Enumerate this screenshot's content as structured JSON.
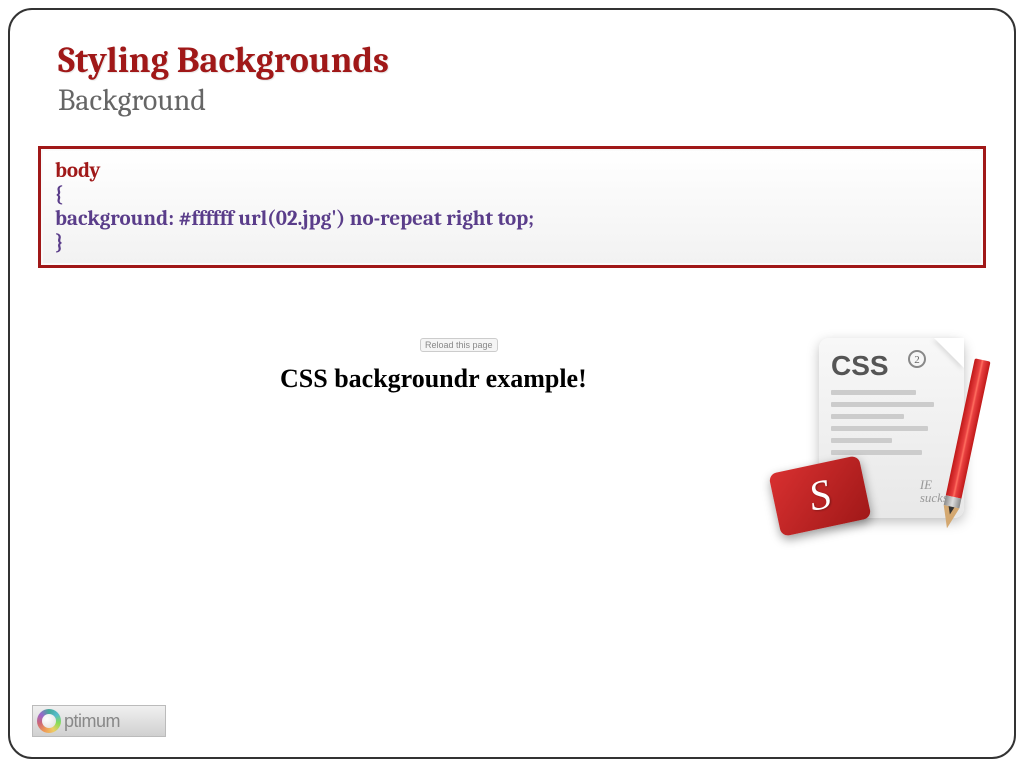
{
  "slide": {
    "title": "Styling Backgrounds",
    "subtitle": "Background"
  },
  "code": {
    "selector": "body",
    "open_brace": "{",
    "property_line": "background: #ffffff  url(02.jpg')  no-repeat  right top;",
    "close_brace": "}"
  },
  "example": {
    "reload_label": "Reload this page",
    "heading": "CSS backgroundr example!",
    "icon": {
      "page_label": "CSS",
      "badge": "2",
      "bottom_text_line1": "IE",
      "bottom_text_line2": "sucks",
      "card_letter": "S"
    }
  },
  "branding": {
    "logo_text": "ptimum"
  }
}
